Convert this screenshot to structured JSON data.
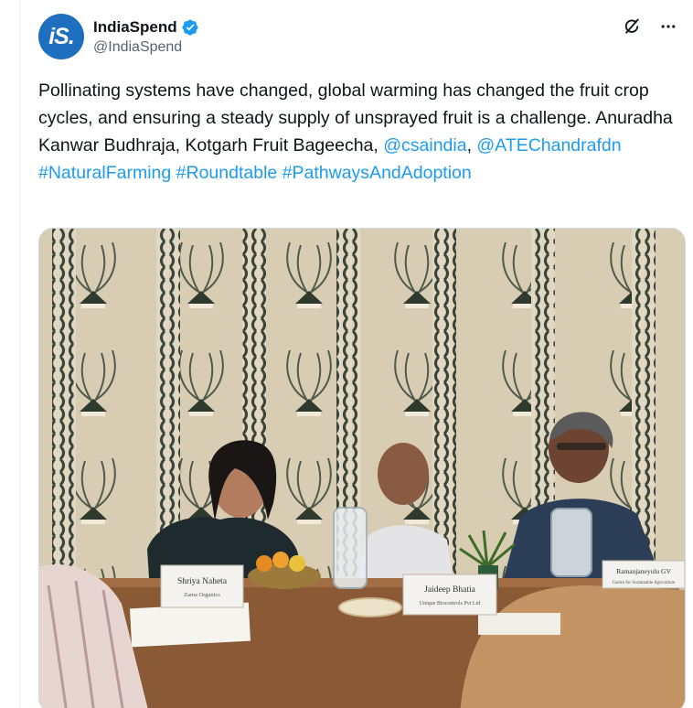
{
  "account": {
    "display_name": "IndiaSpend",
    "handle": "@IndiaSpend",
    "avatar_text": "iS.",
    "verified_color": "#1d9bf0",
    "brand_color": "#1f6fc0"
  },
  "header_icons": [
    "grok-icon",
    "more-icon"
  ],
  "tweet": {
    "text_1": "Pollinating systems have changed, global warming has changed the fruit crop cycles, and ensuring a steady supply of unsprayed fruit is a challenge. Anuradha Kanwar Budhraja, Kotgarh Fruit Bageecha,",
    "mention_1": "@csaindia",
    "sep_1": ",",
    "mention_2": "@ATEChandrafdn",
    "hashtag_1": "#NaturalFarming",
    "hashtag_2": "#Roundtable",
    "hashtag_3": "#PathwaysAndAdoption",
    "link_color": "#1d9bf0"
  },
  "media": {
    "name_cards": [
      {
        "name": "Shriya Naheta",
        "org": "Zama Organics"
      },
      {
        "name": "Jaideep Bhatia",
        "org": "Unique Biocontrols Pvt Ltd"
      },
      {
        "name": "Ramanjaneyulu GV",
        "org": "Centre for Sustainable Agriculture"
      }
    ]
  }
}
